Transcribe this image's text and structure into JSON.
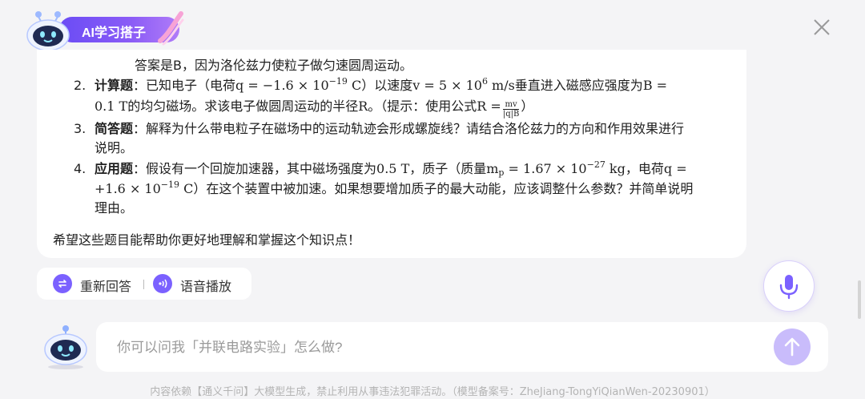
{
  "header": {
    "title": "AI学习搭子"
  },
  "answer": {
    "prev_line": "答案是B，因为洛伦兹力使粒子做匀速圆周运动。",
    "items": [
      {
        "number": "2.",
        "type": "计算题",
        "line1_pre": "：已知电子（电荷",
        "line1_q": "q = −1.6 × 10",
        "line1_q_exp": "−19",
        "line1_q_unit": " C",
        "line1_mid": "）以速度",
        "line1_v": "v = 5 × 10",
        "line1_v_exp": "6",
        "line1_v_unit": " m/s",
        "line1_post": "垂直进入磁感应强度为",
        "line1_B": "B =",
        "line2_val": "0.1 T",
        "line2_text": "的均匀磁场。求该电子做圆周运动的半径",
        "line2_R": "R",
        "line2_hint": "。（提示：使用公式",
        "line2_formula_lhs": "R =",
        "line2_frac_num": "mv",
        "line2_frac_den": "|q|B",
        "line2_end": "）"
      },
      {
        "number": "3.",
        "type": "简答题",
        "line1": "：解释为什么带电粒子在磁场中的运动轨迹会形成螺旋线？请结合洛伦兹力的方向和作用效果进行",
        "line2": "说明。"
      },
      {
        "number": "4.",
        "type": "应用题",
        "line1_pre": "：假设有一个回旋加速器，其中磁场强度为",
        "line1_B": "0.5 T",
        "line1_mid": "，质子（质量",
        "line1_m": "m",
        "line1_m_sub": "p",
        "line1_m_val": " = 1.67 × 10",
        "line1_m_exp": "−27",
        "line1_m_unit": " kg",
        "line1_q_pre": "，电荷",
        "line1_q": "q =",
        "line2_q": "+1.6 × 10",
        "line2_q_exp": "−19",
        "line2_q_unit": " C",
        "line2_text": "）在这个装置中被加速。如果想要增加质子的最大动能，应该调整什么参数？并简单说明",
        "line3": "理由。"
      }
    ],
    "closing": "希望这些题目能帮助你更好地理解和掌握这个知识点！"
  },
  "actions": {
    "regenerate_label": "重新回答",
    "voice_label": "语音播放"
  },
  "input": {
    "placeholder": "你可以问我「并联电路实验」怎么做?"
  },
  "footer": {
    "disclaimer": "内容依赖【通义千问】大模型生成，禁止利用从事违法犯罪活动。（模型备案号：ZheJiang-TongYiQianWen-20230901）"
  },
  "colors": {
    "accent": "#7b61ff",
    "send_button": "#c9bcfb",
    "background": "#f4f4f6"
  },
  "icons": [
    "mascot-icon",
    "close-icon",
    "regenerate-icon",
    "speaker-icon",
    "microphone-icon",
    "arrow-up-icon"
  ]
}
